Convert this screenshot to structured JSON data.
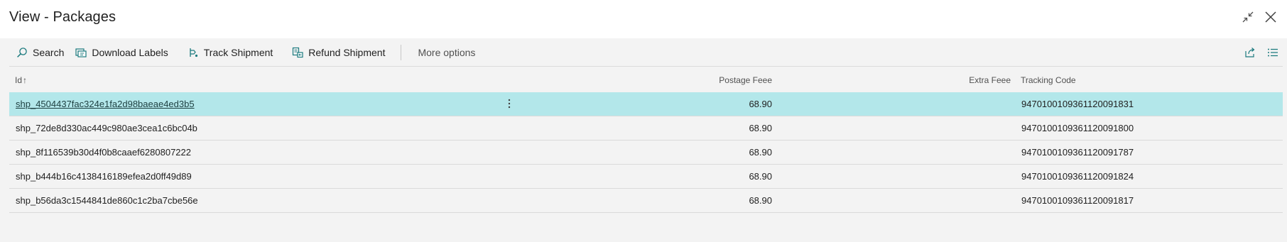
{
  "window": {
    "title": "View - Packages"
  },
  "actions": {
    "search": "Search",
    "download_labels": "Download Labels",
    "track_shipment": "Track Shipment",
    "refund_shipment": "Refund Shipment",
    "more_options": "More options"
  },
  "table": {
    "columns": {
      "id": "Id",
      "id_sort": "↑",
      "postage_fee": "Postage Feee",
      "extra_fee": "Extra Feee",
      "tracking_code": "Tracking Code"
    },
    "rows": [
      {
        "id": "shp_4504437fac324e1fa2d98baeae4ed3b5",
        "postage_fee": "68.90",
        "extra_fee": "",
        "tracking_code": "9470100109361120091831"
      },
      {
        "id": "shp_72de8d330ac449c980ae3cea1c6bc04b",
        "postage_fee": "68.90",
        "extra_fee": "",
        "tracking_code": "9470100109361120091800"
      },
      {
        "id": "shp_8f116539b30d4f0b8caaef6280807222",
        "postage_fee": "68.90",
        "extra_fee": "",
        "tracking_code": "9470100109361120091787"
      },
      {
        "id": "shp_b444b16c4138416189efea2d0ff49d89",
        "postage_fee": "68.90",
        "extra_fee": "",
        "tracking_code": "9470100109361120091824"
      },
      {
        "id": "shp_b56da3c1544841de860c1c2ba7cbe56e",
        "postage_fee": "68.90",
        "extra_fee": "",
        "tracking_code": "9470100109361120091817"
      }
    ]
  },
  "colors": {
    "selected_row": "#b3e7ea",
    "accent_icon": "#1b7a7e",
    "content_background": "#f3f3f3"
  },
  "icons": {
    "search": "search-icon",
    "download_labels": "download-labels-icon",
    "track_shipment": "track-shipment-icon",
    "refund_shipment": "refund-shipment-icon",
    "minimize": "collapse-icon",
    "close": "close-icon",
    "share": "share-icon",
    "list_view": "list-view-icon",
    "row_actions": "kebab-menu-icon"
  }
}
